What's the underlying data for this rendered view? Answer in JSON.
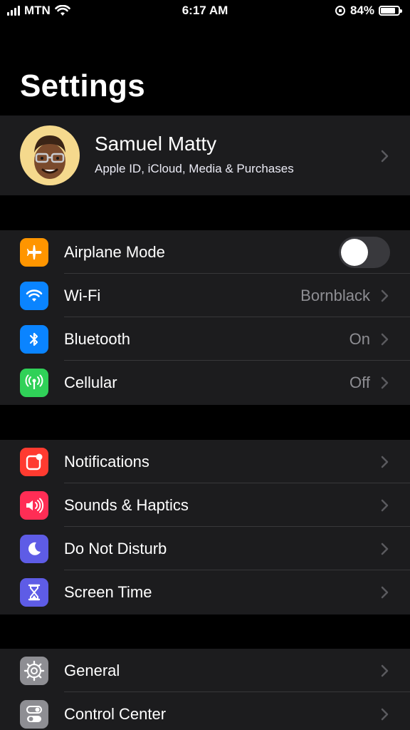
{
  "status_bar": {
    "carrier": "MTN",
    "time": "6:17 AM",
    "battery_percent": "84%",
    "battery_level": 0.84
  },
  "page": {
    "title": "Settings"
  },
  "profile": {
    "name": "Samuel Matty",
    "subtitle": "Apple ID, iCloud, Media & Purchases"
  },
  "group1": {
    "airplane": {
      "label": "Airplane Mode",
      "icon": "airplane-icon",
      "color": "#ff9500",
      "toggle_on": false
    },
    "wifi": {
      "label": "Wi-Fi",
      "value": "Bornblack",
      "icon": "wifi-icon",
      "color": "#0a84ff"
    },
    "bluetooth": {
      "label": "Bluetooth",
      "value": "On",
      "icon": "bluetooth-icon",
      "color": "#0a84ff"
    },
    "cellular": {
      "label": "Cellular",
      "value": "Off",
      "icon": "cellular-icon",
      "color": "#30d158"
    }
  },
  "group2": {
    "notifications": {
      "label": "Notifications",
      "icon": "notifications-icon",
      "color": "#ff3b30"
    },
    "sounds": {
      "label": "Sounds & Haptics",
      "icon": "speaker-icon",
      "color": "#ff2d55"
    },
    "dnd": {
      "label": "Do Not Disturb",
      "icon": "moon-icon",
      "color": "#5e5ce6"
    },
    "screentime": {
      "label": "Screen Time",
      "icon": "hourglass-icon",
      "color": "#5e5ce6"
    }
  },
  "group3": {
    "general": {
      "label": "General",
      "icon": "gear-icon",
      "color": "#8e8e93"
    },
    "control": {
      "label": "Control Center",
      "icon": "toggles-icon",
      "color": "#8e8e93"
    }
  }
}
